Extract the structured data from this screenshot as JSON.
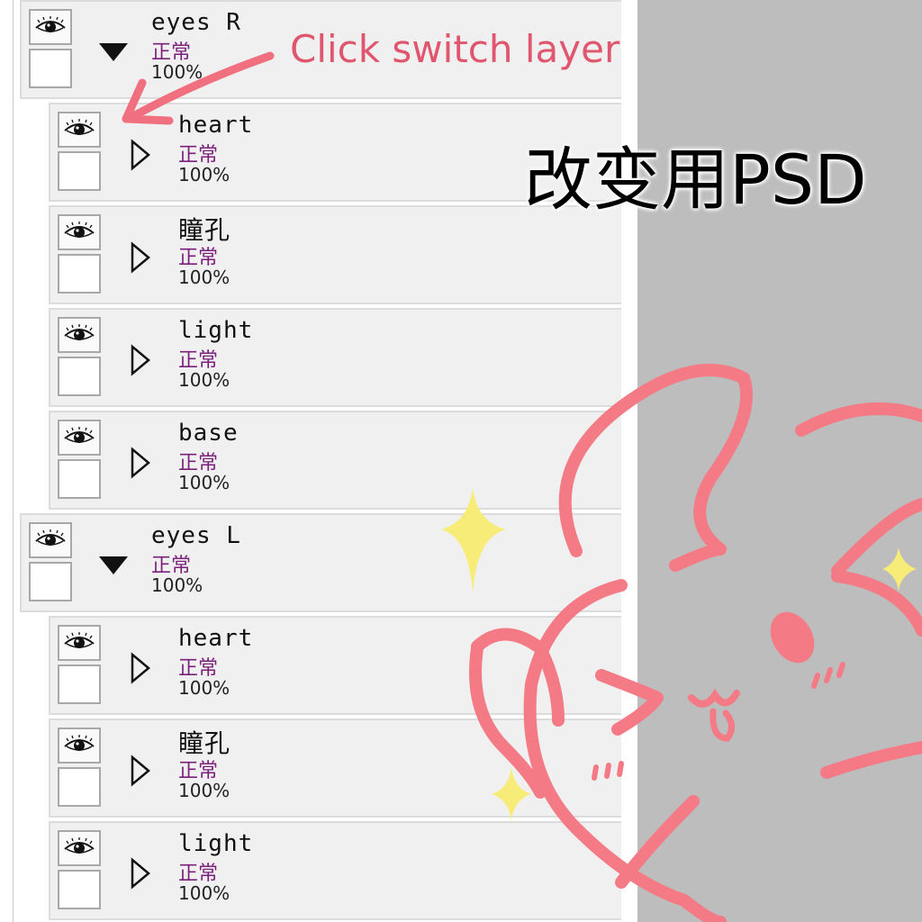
{
  "layers": [
    {
      "name": "eyes R",
      "mode": "正常",
      "opacity": "100%",
      "kind": "group",
      "expanded": true
    },
    {
      "name": "heart",
      "mode": "正常",
      "opacity": "100%",
      "kind": "layer",
      "expanded": false
    },
    {
      "name": "瞳孔",
      "mode": "正常",
      "opacity": "100%",
      "kind": "layer",
      "expanded": false
    },
    {
      "name": "light",
      "mode": "正常",
      "opacity": "100%",
      "kind": "layer",
      "expanded": false
    },
    {
      "name": "base",
      "mode": "正常",
      "opacity": "100%",
      "kind": "layer",
      "expanded": false
    },
    {
      "name": "eyes L",
      "mode": "正常",
      "opacity": "100%",
      "kind": "group",
      "expanded": true
    },
    {
      "name": "heart",
      "mode": "正常",
      "opacity": "100%",
      "kind": "layer",
      "expanded": false
    },
    {
      "name": "瞳孔",
      "mode": "正常",
      "opacity": "100%",
      "kind": "layer",
      "expanded": false
    },
    {
      "name": "light",
      "mode": "正常",
      "opacity": "100%",
      "kind": "layer",
      "expanded": false
    }
  ],
  "annotations": {
    "hint": "Click switch layer",
    "title": "改变用PSD"
  },
  "colors": {
    "accent_pink": "#e0566e",
    "doodle_pink": "#f47a86",
    "sparkle_yellow": "#f7ec77",
    "background_gray": "#bdbdbd",
    "mode_purple": "#7a1f7a"
  },
  "icons": {
    "visibility": "eye-icon",
    "group_expander": "triangle-down-icon",
    "layer_expander": "triangle-right-outline-icon",
    "arrow": "curved-arrow-icon"
  }
}
